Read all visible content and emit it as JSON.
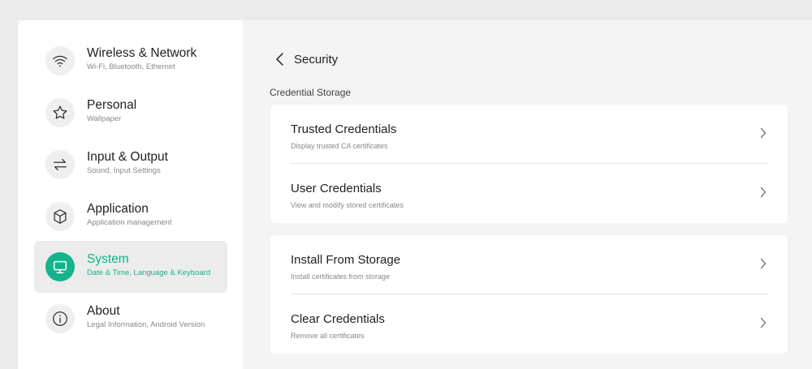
{
  "sidebar": {
    "items": [
      {
        "icon": "wifi-icon",
        "title": "Wireless & Network",
        "subtitle": "Wi-Fi, Bluetooth, Ethernet",
        "active": false
      },
      {
        "icon": "star-icon",
        "title": "Personal",
        "subtitle": "Wallpaper",
        "active": false
      },
      {
        "icon": "swap-arrows-icon",
        "title": "Input & Output",
        "subtitle": "Sound, Input Settings",
        "active": false
      },
      {
        "icon": "cube-icon",
        "title": "Application",
        "subtitle": "Application management",
        "active": false
      },
      {
        "icon": "monitor-icon",
        "title": "System",
        "subtitle": "Date & Time, Language & Keyboard",
        "active": true
      },
      {
        "icon": "info-icon",
        "title": "About",
        "subtitle": "Legal Information, Android Version",
        "active": false
      }
    ]
  },
  "header": {
    "title": "Security",
    "back_icon": "chevron-left-icon"
  },
  "section": {
    "label": "Credential Storage"
  },
  "cards": [
    {
      "rows": [
        {
          "title": "Trusted Credentials",
          "subtitle": "Display trusted CA certificates"
        },
        {
          "title": "User Credentials",
          "subtitle": "View and modify stored certificates"
        }
      ]
    },
    {
      "rows": [
        {
          "title": "Install From Storage",
          "subtitle": "Install certificates from storage"
        },
        {
          "title": "Clear Credentials",
          "subtitle": "Remove all certificates"
        }
      ]
    }
  ],
  "colors": {
    "accent": "#15b38c",
    "background": "#f4f4f4",
    "card": "#ffffff"
  }
}
